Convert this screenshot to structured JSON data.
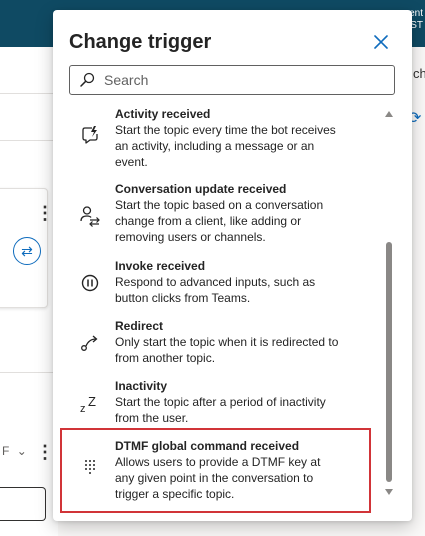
{
  "background": {
    "header_text_line1": "ent",
    "header_text_line2": "ST",
    "right_text": "ch",
    "right_icon": "refresh-icon",
    "dropdown_text": "F",
    "switch_icon": "switch-icon"
  },
  "dialog": {
    "title": "Change trigger",
    "close_icon": "close-icon",
    "search": {
      "placeholder": "Search",
      "value": "",
      "icon": "search-icon"
    },
    "items": [
      {
        "title": "Activity received",
        "description": "Start the topic every time the bot receives an activity, including a message or an event.",
        "icon": "activity-icon"
      },
      {
        "title": "Conversation update received",
        "description": "Start the topic based on a conversation change from a client, like adding or removing users or channels.",
        "icon": "conversation-update-icon"
      },
      {
        "title": "Invoke received",
        "description": "Respond to advanced inputs, such as button clicks from Teams.",
        "icon": "invoke-icon"
      },
      {
        "title": "Redirect",
        "description": "Only start the topic when it is redirected to from another topic.",
        "icon": "redirect-icon"
      },
      {
        "title": "Inactivity",
        "description": "Start the topic after a period of inactivity from the user.",
        "icon": "inactivity-icon"
      },
      {
        "title": "DTMF global command received",
        "description": "Allows users to provide a DTMF key at any given point in the conversation to trigger a specific topic.",
        "icon": "dialpad-icon"
      }
    ]
  },
  "colors": {
    "highlight": "#d13438",
    "header": "#0f4a63",
    "accent": "#0f6cbd"
  }
}
